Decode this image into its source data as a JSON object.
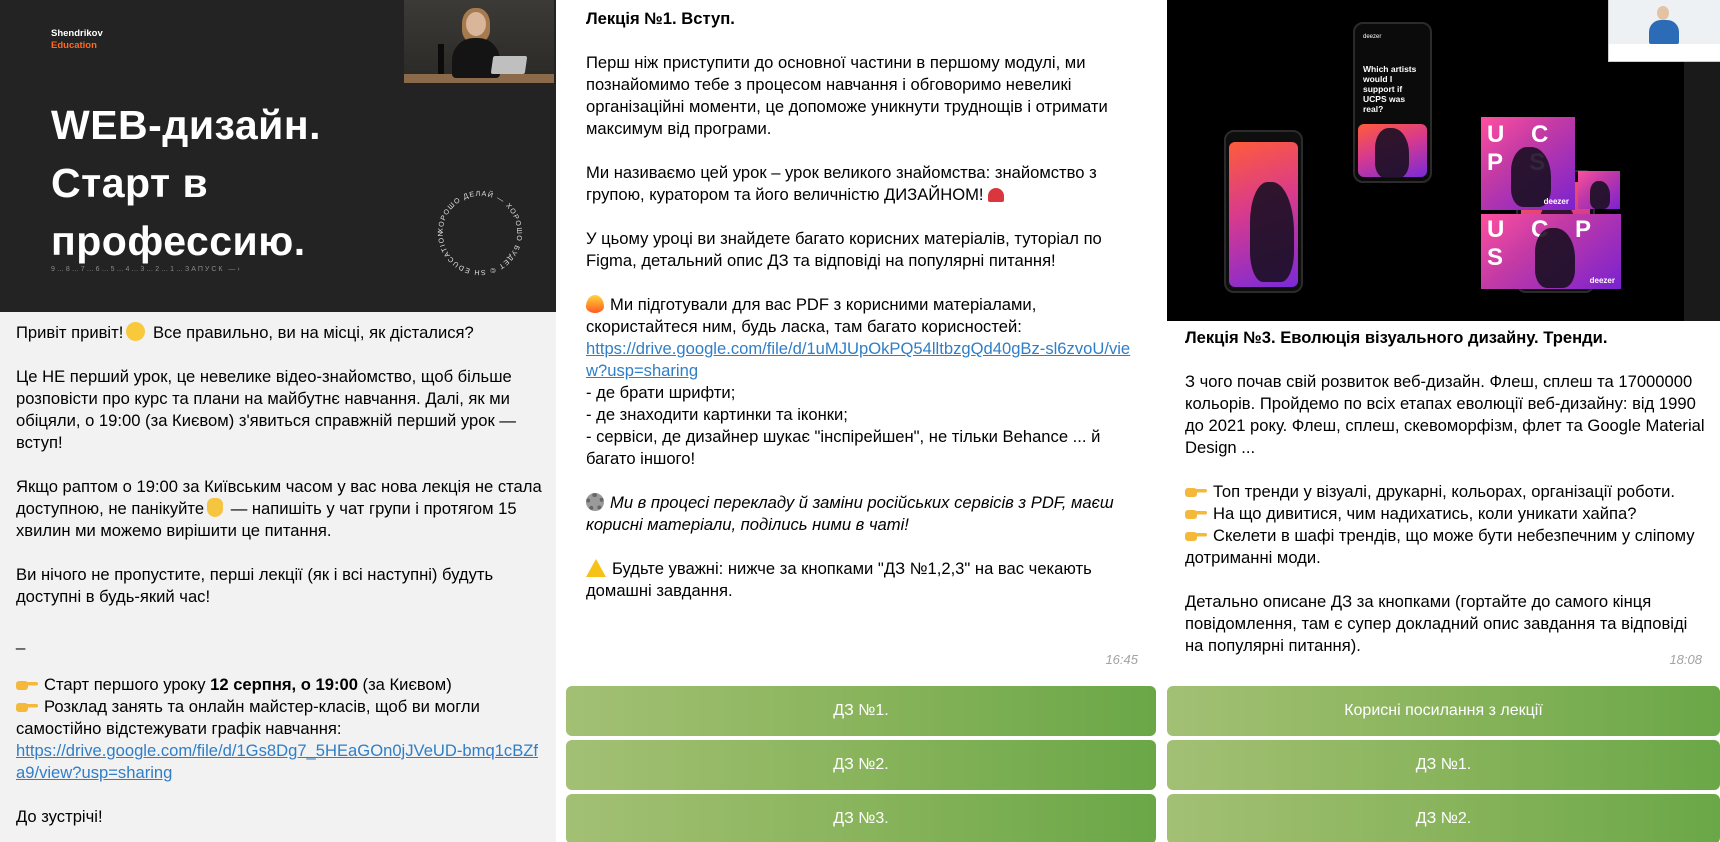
{
  "col1": {
    "hero": {
      "brand_line1": "Shendrikov",
      "brand_line2": "Education",
      "title_line1": "WEB-дизайн.",
      "title_line2": "Старт в профессию.",
      "countdown": "9…8…7…6…5…4…3…2…1…ЗАПУСК  —›",
      "ring_text": "ХОРОШО ДЕЛАЙ — ХОРОШО БУДЕТ © SH EDUCATION"
    },
    "message": {
      "p1": "Привіт привіт!",
      "p1b": "Все правильно, ви на місці, як дісталися?",
      "p2": "Це НЕ перший урок, це невелике відео-знайомство, щоб більше розповісти про курс та плани на майбутнє навчання. Далі, як ми обіцяли, о 19:00 (за Києвом) з'явиться справжній перший урок —вступ!",
      "p3a": "Якщо раптом о 19:00 за Київським часом у вас нова лекція не стала доступною, не панікуйте",
      "p3b": "— напишіть у чат групи і протягом 15 хвилин ми можемо вирішити це питання.",
      "p4": "Ви нічого не пропустите, перші лекції (як і всі наступні) будуть доступні в будь-який час!",
      "dash": "_",
      "start_a": "Старт першого уроку ",
      "start_bold": "12 серпня, о 19:00",
      "start_c": " (за Києвом)",
      "schedule": "Розклад занять та онлайн майстер-класів, щоб ви могли самостійно відстежувати графік навчання:",
      "schedule_link": "https://drive.google.com/file/d/1Gs8Dg7_5HEaGOn0jJVeUD-bmq1cBZfa9/view?usp=sharing",
      "bye": "До зустрічі!"
    }
  },
  "col2": {
    "title": "Лекція №1. Вступ.",
    "p1": "Перш ніж приступити до основної частини в першому модулі, ми познайомимо тебе з процесом навчання і обговоримо невеликі організаційні моменти, це допоможе уникнути труднощів і отримати максимум від програми.",
    "p2": "Ми називаємо цей урок – урок великого знайомства: знайомство з групою, куратором та його величністю ДИЗАЙНОМ!",
    "p3": "У цьому уроці ви знайдете багато корисних матеріалів, туторіал по Figma, детальний опис ДЗ та відповіді на популярні питання!",
    "p4": "Ми підготували для вас PDF з корисними матеріалами, скористайтеся ним, будь ласка, там багато корисностей:",
    "p4_link": "https://drive.google.com/file/d/1uMJUpOkPQ54lltbzgQd40gBz-sl6zvoU/view?usp=sharing",
    "bullets": [
      "- де брати шрифти;",
      "- де знаходити картинки та іконки;",
      "- сервіси, де дизайнер шукає \"інспірейшен\", не тільки Behance ... й багато іншого!"
    ],
    "p5": "Ми в процесі перекладу й заміни російських сервісів з PDF, маєш корисні матеріали, поділись ними в чаті!",
    "p6": "Будьте уважні: нижче за кнопками \"ДЗ №1,2,3\" на вас чекають домашні завдання.",
    "time": "16:45",
    "buttons": [
      "ДЗ №1.",
      "ДЗ №2.",
      "ДЗ №3."
    ]
  },
  "col3": {
    "preview": {
      "phone_logo": "deezer",
      "phone_text": "Which artists would I support if UCPS was real?",
      "card_letters": "U C P S",
      "card_brand": "deezer"
    },
    "title": "Лекція №3. Еволюція візуального дизайну. Тренди.",
    "p1": "З чого почав свій розвиток веб-дизайн. Флеш, сплеш та 17000000 кольорів. Пройдемо по всіх етапах еволюції веб-дизайну: від 1990 до 2021 року. Флеш, сплеш, скевоморфізм, флет та Google Material Design ...",
    "bullets": [
      "Топ тренди у візуалі, друкарні, кольорах, організації роботи.",
      "На що дивитися, чим надихатись, коли уникати хайпа?",
      "Скелети в шафі трендів, що може бути небезпечним у сліпому дотриманні моди."
    ],
    "p2": "Детально описане ДЗ за кнопками (гортайте до самого кінця повідомлення, там є супер докладний опис завдання та відповіді на популярні питання).",
    "time": "18:08",
    "buttons": [
      "Корисні посилання з лекції",
      "ДЗ №1.",
      "ДЗ №2."
    ]
  }
}
